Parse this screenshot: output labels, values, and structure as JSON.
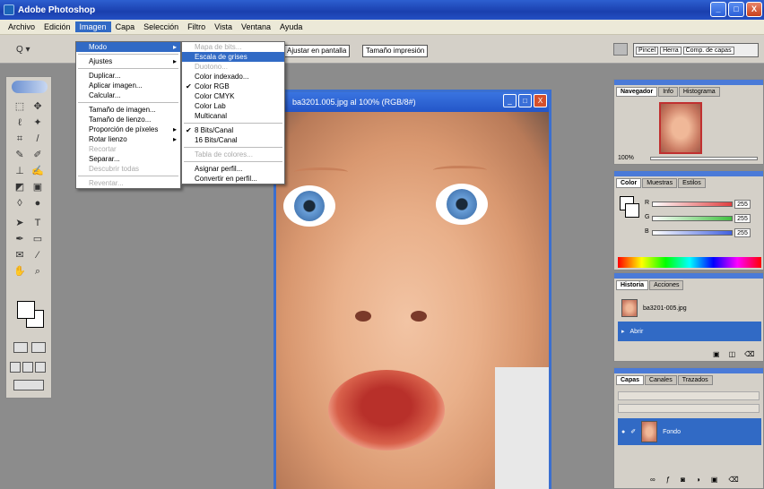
{
  "window": {
    "title": "Adobe Photoshop",
    "buttons": [
      "_",
      "□",
      "X"
    ]
  },
  "menubar": [
    "Archivo",
    "Edición",
    "Imagen",
    "Capa",
    "Selección",
    "Filtro",
    "Vista",
    "Ventana",
    "Ayuda"
  ],
  "options": {
    "tool_glyph": "Q ▾",
    "buttons": [
      "Ajustar en pantalla",
      "Tamaño impresión"
    ],
    "palette_well": [
      "Pincel",
      "Herra",
      "Comp. de capas"
    ]
  },
  "document": {
    "title": "ba3201.005.jpg al 100% (RGB/8#)",
    "buttons": [
      "_",
      "□",
      "X"
    ]
  },
  "imagen_menu": [
    {
      "label": "Modo",
      "state": "highlight",
      "submenu": true
    },
    {
      "sep": true
    },
    {
      "label": "Ajustes",
      "submenu": true
    },
    {
      "sep": true
    },
    {
      "label": "Duplicar..."
    },
    {
      "label": "Aplicar imagen..."
    },
    {
      "label": "Calcular..."
    },
    {
      "sep": true
    },
    {
      "label": "Tamaño de imagen..."
    },
    {
      "label": "Tamaño de lienzo..."
    },
    {
      "label": "Proporción de píxeles",
      "submenu": true
    },
    {
      "label": "Rotar lienzo",
      "submenu": true
    },
    {
      "label": "Recortar",
      "state": "disabled"
    },
    {
      "label": "Separar..."
    },
    {
      "label": "Descubrir todas",
      "state": "disabled"
    },
    {
      "sep": true
    },
    {
      "label": "Reventar...",
      "state": "disabled"
    }
  ],
  "modo_menu": [
    {
      "label": "Mapa de bits...",
      "state": "disabled"
    },
    {
      "label": "Escala de grises",
      "state": "highlight"
    },
    {
      "label": "Duotono...",
      "state": "disabled"
    },
    {
      "label": "Color indexado..."
    },
    {
      "label": "Color RGB",
      "checked": true
    },
    {
      "label": "Color CMYK"
    },
    {
      "label": "Color Lab"
    },
    {
      "label": "Multicanal"
    },
    {
      "sep": true
    },
    {
      "label": "8 Bits/Canal",
      "checked": true
    },
    {
      "label": "16 Bits/Canal"
    },
    {
      "sep": true
    },
    {
      "label": "Tabla de colores...",
      "state": "disabled"
    },
    {
      "sep": true
    },
    {
      "label": "Asignar perfil..."
    },
    {
      "label": "Convertir en perfil..."
    }
  ],
  "navigator": {
    "tabs": [
      "Navegador",
      "Info",
      "Histograma"
    ],
    "zoom": "100%"
  },
  "color": {
    "tabs": [
      "Color",
      "Muestras",
      "Estilos"
    ],
    "channels": [
      {
        "label": "R",
        "value": "255",
        "color": "#e04040"
      },
      {
        "label": "G",
        "value": "255",
        "color": "#40c040"
      },
      {
        "label": "B",
        "value": "255",
        "color": "#4060e0"
      }
    ]
  },
  "history": {
    "tabs": [
      "Historia",
      "Acciones"
    ],
    "items": [
      {
        "label": "ba3201-005.jpg",
        "highlight": false
      },
      {
        "label": "Abrir",
        "highlight": true
      }
    ]
  },
  "layers": {
    "tabs": [
      "Capas",
      "Canales",
      "Trazados"
    ],
    "layer": "Fondo"
  }
}
